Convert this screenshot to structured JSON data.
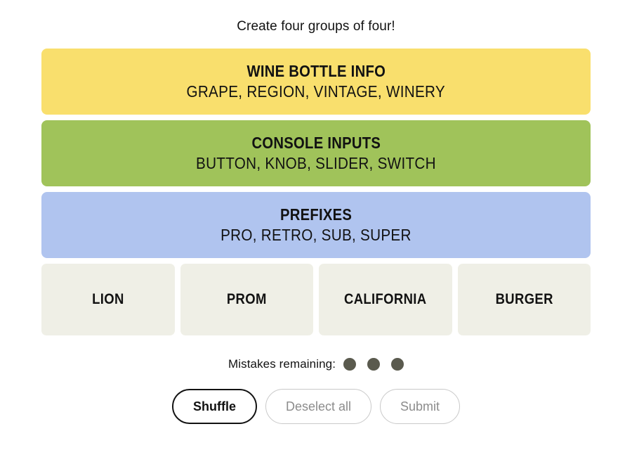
{
  "instruction": "Create four groups of four!",
  "solved_groups": [
    {
      "title": "WINE BOTTLE INFO",
      "members": "GRAPE, REGION, VINTAGE, WINERY",
      "color": "#f9df6d"
    },
    {
      "title": "CONSOLE INPUTS",
      "members": "BUTTON, KNOB, SLIDER, SWITCH",
      "color": "#a0c35a"
    },
    {
      "title": "PREFIXES",
      "members": "PRO, RETRO, SUB, SUPER",
      "color": "#b0c4ef"
    }
  ],
  "tiles": [
    {
      "label": "LION"
    },
    {
      "label": "PROM"
    },
    {
      "label": "CALIFORNIA"
    },
    {
      "label": "BURGER"
    }
  ],
  "mistakes": {
    "label": "Mistakes remaining:",
    "remaining": 3,
    "dot_color": "#5a5a4e"
  },
  "buttons": [
    {
      "label": "Shuffle",
      "state": "active"
    },
    {
      "label": "Deselect all",
      "state": "disabled"
    },
    {
      "label": "Submit",
      "state": "disabled"
    }
  ]
}
